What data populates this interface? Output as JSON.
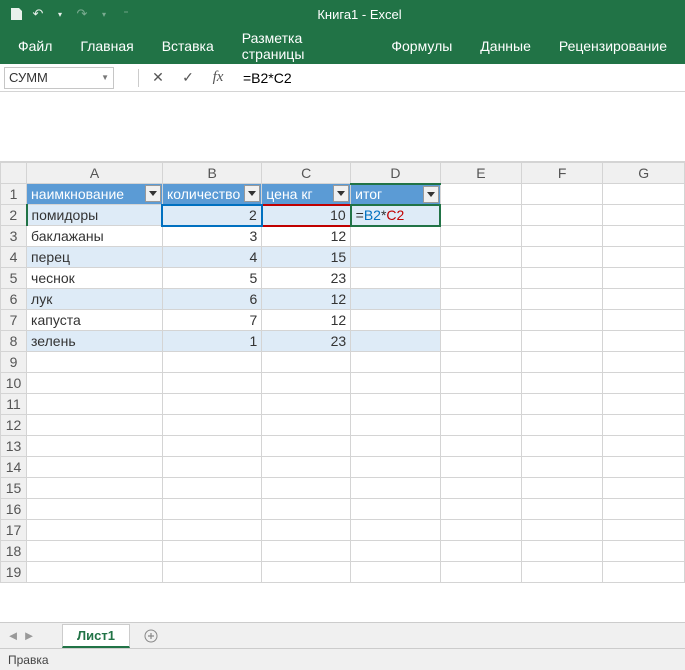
{
  "app": {
    "title": "Книга1 - Excel"
  },
  "qat": {
    "save": "save",
    "undo": "undo",
    "redo": "redo"
  },
  "ribbon": {
    "tabs": [
      "Файл",
      "Главная",
      "Вставка",
      "Разметка страницы",
      "Формулы",
      "Данные",
      "Рецензирование"
    ]
  },
  "namebox": {
    "value": "СУММ"
  },
  "formula": {
    "value": "=B2*C2"
  },
  "columns": [
    "A",
    "B",
    "C",
    "D",
    "E",
    "F",
    "G"
  ],
  "active": {
    "col": "D",
    "row": 2
  },
  "table": {
    "headers": [
      "наимкнование",
      "количество",
      "цена кг",
      "итог"
    ],
    "rows": [
      {
        "a": "помидоры",
        "b": "2",
        "c": "10",
        "d_parts": [
          "=",
          "B2",
          "*",
          "C2"
        ]
      },
      {
        "a": "баклажаны",
        "b": "3",
        "c": "12",
        "d": ""
      },
      {
        "a": "перец",
        "b": "4",
        "c": "15",
        "d": ""
      },
      {
        "a": "чеснок",
        "b": "5",
        "c": "23",
        "d": ""
      },
      {
        "a": "лук",
        "b": "6",
        "c": "12",
        "d": ""
      },
      {
        "a": "капуста",
        "b": "7",
        "c": "12",
        "d": ""
      },
      {
        "a": "зелень",
        "b": "1",
        "c": "23",
        "d": ""
      }
    ]
  },
  "sheet": {
    "name": "Лист1"
  },
  "status": {
    "mode": "Правка"
  }
}
